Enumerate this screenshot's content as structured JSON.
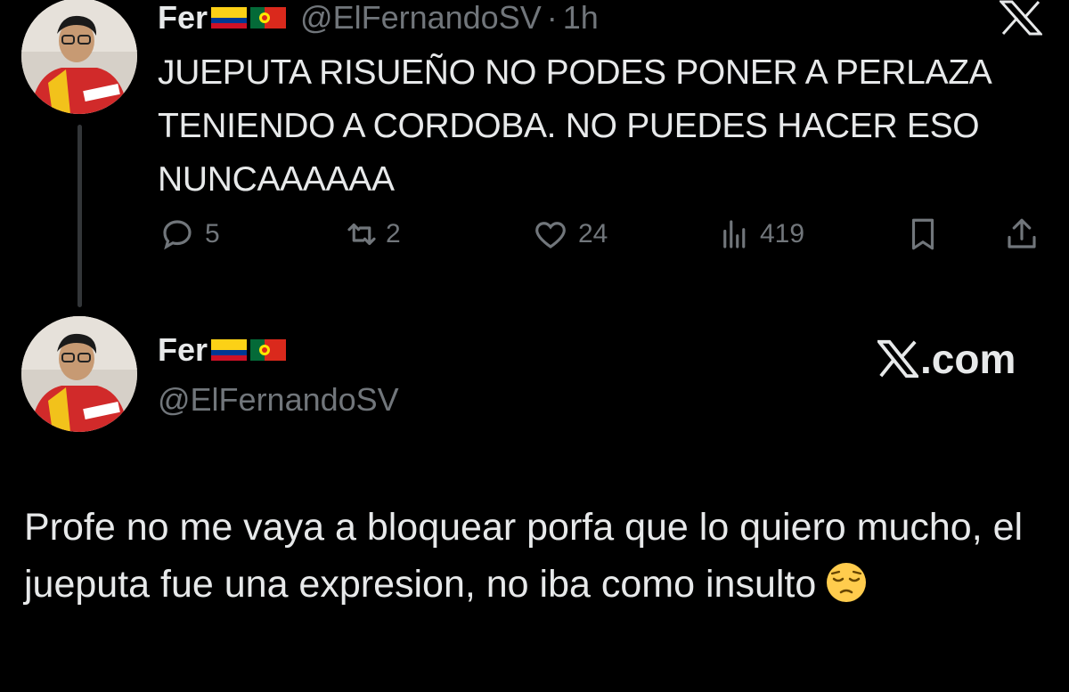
{
  "tweet1": {
    "display_name": "Fer",
    "flags": [
      "flag-colombia",
      "flag-portugal"
    ],
    "handle": "@ElFernandoSV",
    "separator": "·",
    "time": "1h",
    "text": "JUEPUTA RISUEÑO NO PODES PONER A PERLAZA TENIENDO A CORDOBA. NO PUEDES HACER ESO NUNCAAAAAA",
    "actions": {
      "replies": "5",
      "retweets": "2",
      "likes": "24",
      "views": "419"
    }
  },
  "tweet2": {
    "display_name": "Fer",
    "flags": [
      "flag-colombia",
      "flag-portugal"
    ],
    "handle": "@ElFernandoSV",
    "brand": ".com",
    "text": "Profe no me vaya a bloquear porfa que lo quiero mucho, el jueputa fue una expresion, no iba como insulto",
    "emoji": "pensive-face-emoji"
  },
  "colors": {
    "background": "#000000",
    "text": "#e7e9ea",
    "muted": "#71767b",
    "thread_line": "#333639"
  }
}
